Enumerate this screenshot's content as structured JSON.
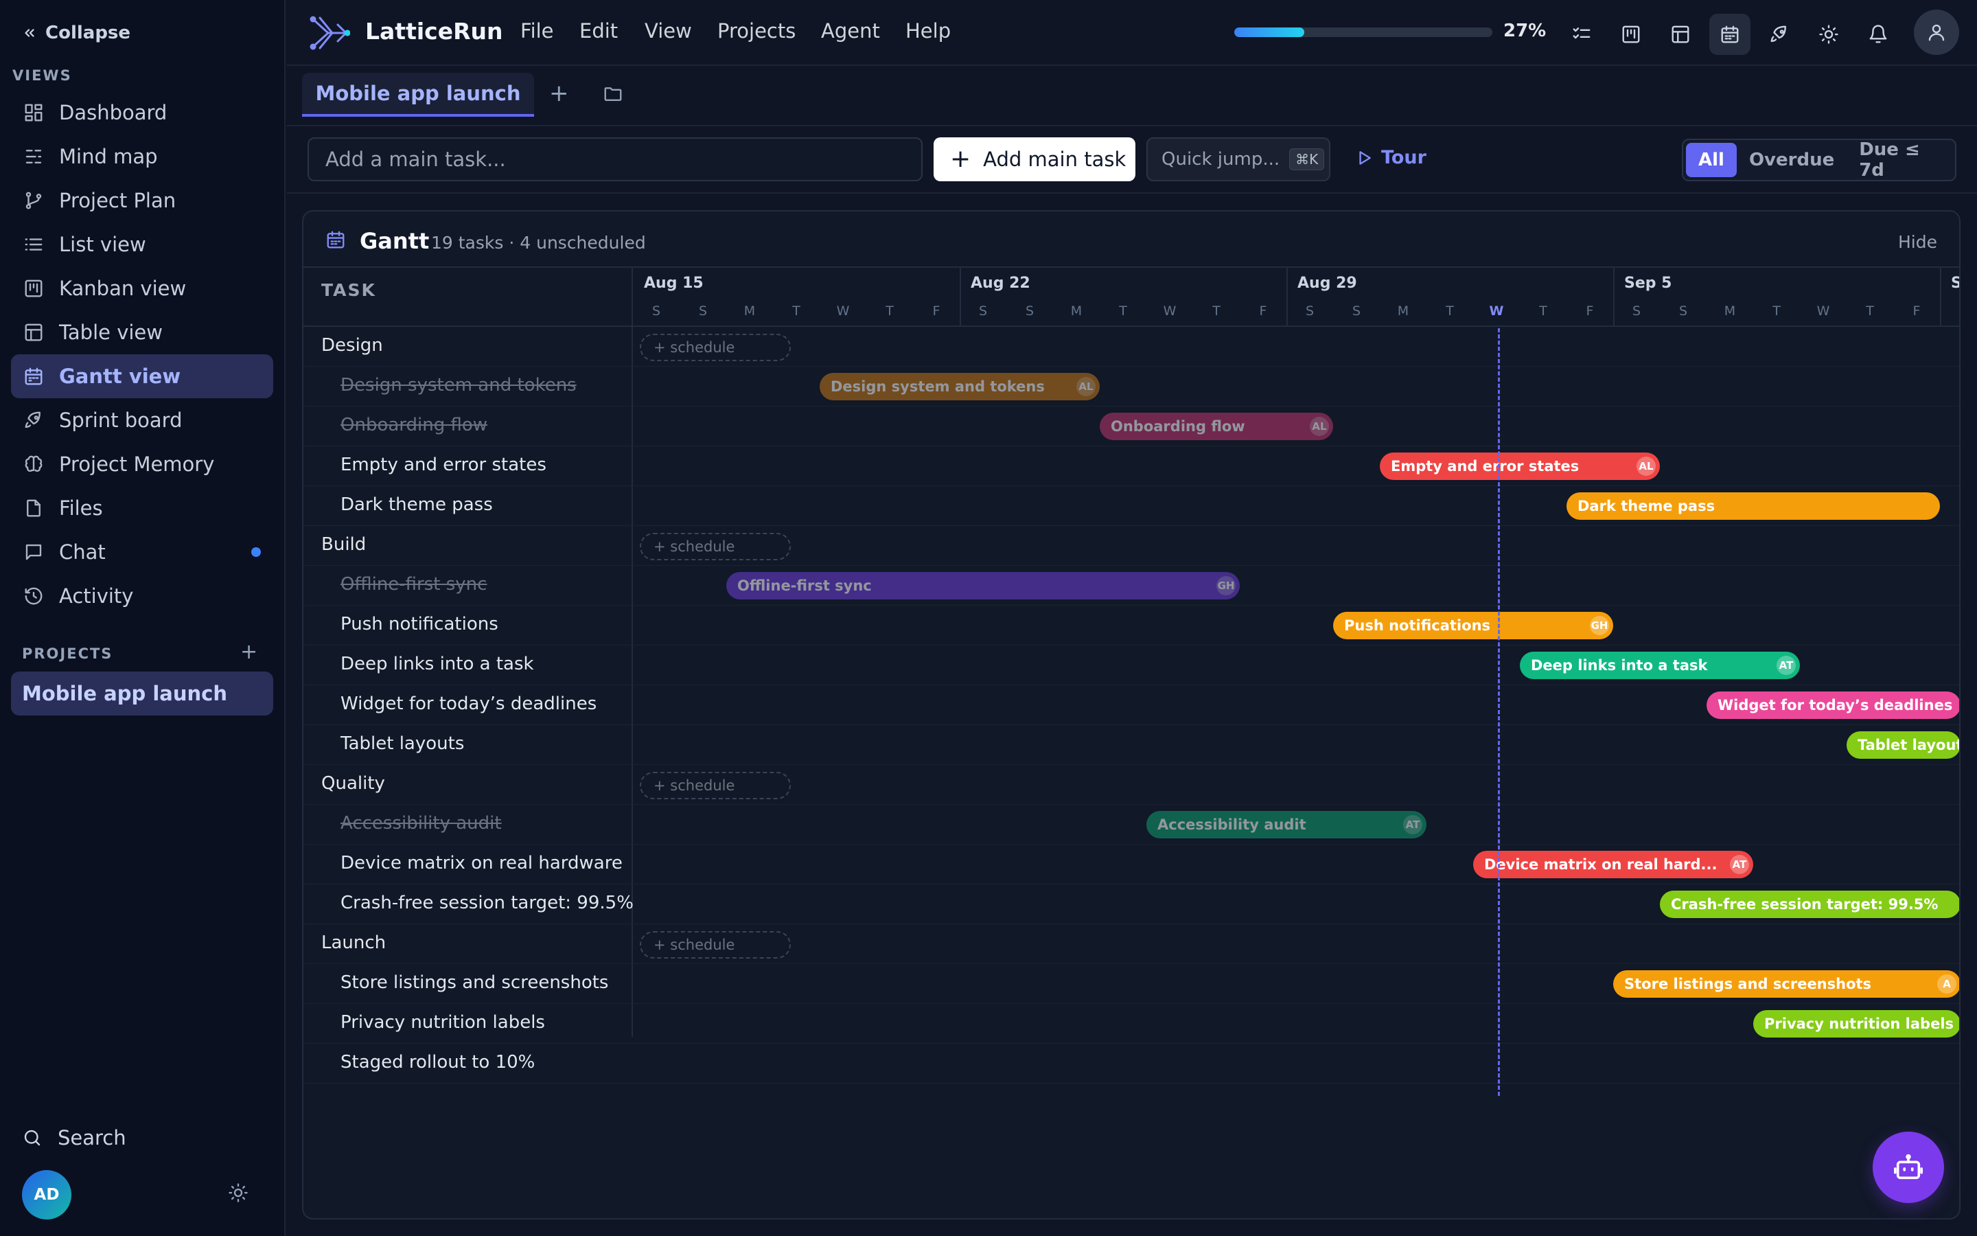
{
  "app": {
    "name": "LatticeRun"
  },
  "menu": [
    "File",
    "Edit",
    "View",
    "Projects",
    "Agent",
    "Help"
  ],
  "progress": {
    "value": 27,
    "label": "27%"
  },
  "sidebar": {
    "collapse_label": "Collapse",
    "views_heading": "VIEWS",
    "items": [
      {
        "label": "Dashboard",
        "icon": "dashboard-icon"
      },
      {
        "label": "Mind map",
        "icon": "mind-map-icon"
      },
      {
        "label": "Project Plan",
        "icon": "branch-icon"
      },
      {
        "label": "List view",
        "icon": "list-icon"
      },
      {
        "label": "Kanban view",
        "icon": "kanban-icon"
      },
      {
        "label": "Table view",
        "icon": "table-icon"
      },
      {
        "label": "Gantt view",
        "icon": "calendar-icon"
      },
      {
        "label": "Sprint board",
        "icon": "rocket-icon"
      },
      {
        "label": "Project Memory",
        "icon": "brain-icon"
      },
      {
        "label": "Files",
        "icon": "file-icon"
      },
      {
        "label": "Chat",
        "icon": "chat-icon"
      },
      {
        "label": "Activity",
        "icon": "history-icon"
      }
    ],
    "active_item": "Gantt view",
    "projects_heading": "PROJECTS",
    "projects": [
      "Mobile app launch"
    ],
    "search_label": "Search",
    "user_initials": "AD"
  },
  "tabs": {
    "active": "Mobile app launch"
  },
  "toolbar": {
    "add_placeholder": "Add a main task...",
    "add_button": "Add main task",
    "quick_jump": "Quick jump...",
    "quick_jump_kbd": "⌘K",
    "tour": "Tour",
    "filters": [
      "All",
      "Overdue",
      "Due ≤ 7d"
    ],
    "active_filter": "All"
  },
  "gantt": {
    "title": "Gantt",
    "subtitle": "19 tasks · 4 unscheduled",
    "hide_label": "Hide",
    "task_header": "TASK",
    "weeks": [
      "Aug 15",
      "Aug 22",
      "Aug 29",
      "Sep 5",
      "S"
    ],
    "day_letters": [
      "S",
      "S",
      "M",
      "T",
      "W",
      "T",
      "F",
      "S",
      "S",
      "M",
      "T",
      "W",
      "T",
      "F",
      "S",
      "S",
      "M",
      "T",
      "W",
      "T",
      "F",
      "S",
      "S",
      "M",
      "T",
      "W",
      "T",
      "F",
      "S"
    ],
    "today_index": 18,
    "schedule_label": "+ schedule",
    "rows": [
      {
        "type": "group",
        "label": "Design"
      },
      {
        "type": "task",
        "label": "Design system and tokens",
        "done": true,
        "bar": {
          "start": 4,
          "end": 10,
          "color": "#c2771a",
          "avatar": "AL"
        }
      },
      {
        "type": "task",
        "label": "Onboarding flow",
        "done": true,
        "bar": {
          "start": 10,
          "end": 15,
          "color": "#be3670",
          "avatar": "AL"
        }
      },
      {
        "type": "task",
        "label": "Empty and error states",
        "done": false,
        "bar": {
          "start": 16,
          "end": 22,
          "color": "#ef4444",
          "avatar": "AL"
        }
      },
      {
        "type": "task",
        "label": "Dark theme pass",
        "done": false,
        "bar": {
          "start": 20,
          "end": 28,
          "color": "#f59e0b",
          "avatar": ""
        }
      },
      {
        "type": "group",
        "label": "Build"
      },
      {
        "type": "task",
        "label": "Offline-first sync",
        "done": true,
        "bar": {
          "start": 2,
          "end": 13,
          "color": "#6d3fd8",
          "avatar": "GH"
        }
      },
      {
        "type": "task",
        "label": "Push notifications",
        "done": false,
        "bar": {
          "start": 15,
          "end": 21,
          "color": "#f59e0b",
          "avatar": "GH"
        }
      },
      {
        "type": "task",
        "label": "Deep links into a task",
        "done": false,
        "bar": {
          "start": 19,
          "end": 25,
          "color": "#10b981",
          "avatar": "AT"
        }
      },
      {
        "type": "task",
        "label": "Widget for today’s deadlines",
        "done": false,
        "bar": {
          "start": 23,
          "end": 29,
          "color": "#ec4899",
          "avatar": ""
        }
      },
      {
        "type": "task",
        "label": "Tablet layouts",
        "done": false,
        "bar": {
          "start": 26,
          "end": 29,
          "color": "#84cc16",
          "avatar": ""
        }
      },
      {
        "type": "group",
        "label": "Quality"
      },
      {
        "type": "task",
        "label": "Accessibility audit",
        "done": true,
        "bar": {
          "start": 11,
          "end": 17,
          "color": "#10a070",
          "avatar": "AT"
        }
      },
      {
        "type": "task",
        "label": "Device matrix on real hardware",
        "done": false,
        "bar": {
          "start": 18,
          "end": 24,
          "color": "#ef4444",
          "avatar": "AT",
          "text": "Device matrix on real hard..."
        }
      },
      {
        "type": "task",
        "label": "Crash-free session target: 99.5%",
        "done": false,
        "bar": {
          "start": 22,
          "end": 29,
          "color": "#84cc16",
          "avatar": ""
        }
      },
      {
        "type": "group",
        "label": "Launch"
      },
      {
        "type": "task",
        "label": "Store listings and screenshots",
        "done": false,
        "bar": {
          "start": 21,
          "end": 29,
          "color": "#f59e0b",
          "avatar": "A"
        }
      },
      {
        "type": "task",
        "label": "Privacy nutrition labels",
        "done": false,
        "bar": {
          "start": 24,
          "end": 29,
          "color": "#84cc16",
          "avatar": ""
        }
      },
      {
        "type": "task",
        "label": "Staged rollout to 10%",
        "done": false,
        "bar": null
      }
    ]
  }
}
